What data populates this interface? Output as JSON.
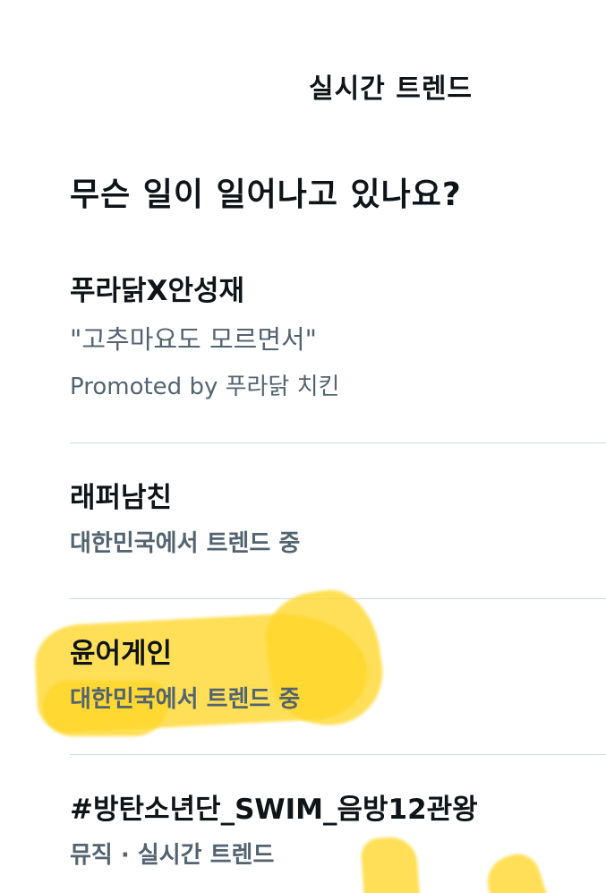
{
  "header": {
    "title": "실시간 트렌드"
  },
  "section": {
    "heading": "무슨 일이 일어나고 있나요?"
  },
  "trends": [
    {
      "title": "푸라닭X안성재",
      "quote": "\"고추마요도 모르면서\"",
      "meta": "Promoted by 푸라닭 치킨"
    },
    {
      "title": "래퍼남친",
      "meta": "대한민국에서 트렌드 중"
    },
    {
      "title": "윤어게인",
      "meta": "대한민국에서 트렌드 중",
      "highlighted": true
    },
    {
      "title": "#방탄소년단_SWIM_음방12관왕",
      "meta": "뮤직 · 실시간 트렌드"
    }
  ],
  "colors": {
    "text_primary": "#0f1419",
    "text_secondary": "#536471",
    "divider": "#cfd9de",
    "highlighter": "#ffd628"
  }
}
